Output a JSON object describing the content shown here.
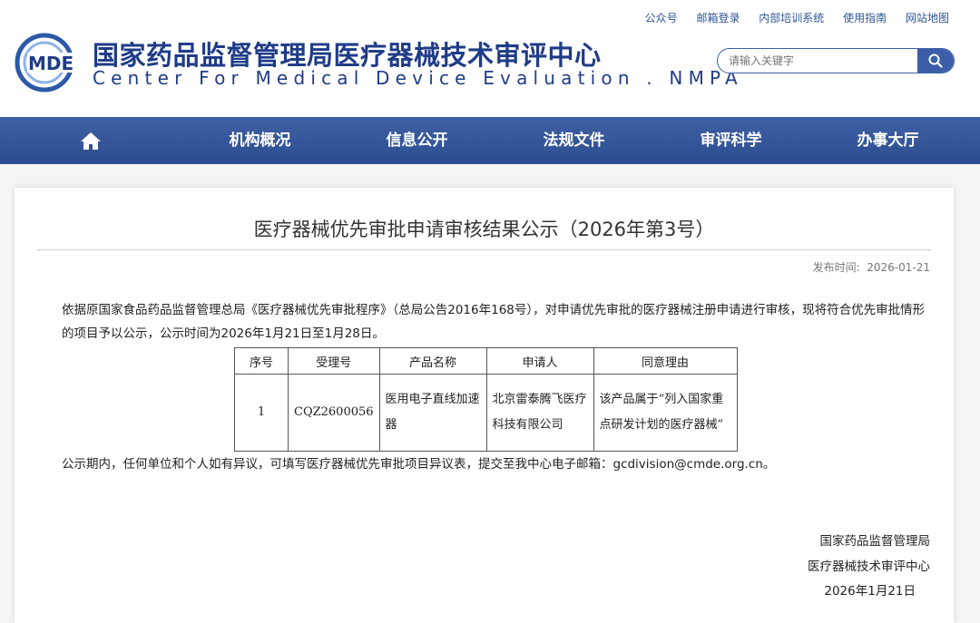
{
  "header": {
    "top_links": [
      "公众号",
      "邮箱登录",
      "内部培训系统",
      "使用指南",
      "网站地图"
    ],
    "logo_mark": "MDE",
    "logo_cn": "国家药品监督管理局医疗器械技术审评中心",
    "logo_en": "Center For Medical Device Evaluation . NMPA",
    "search_placeholder": "请输入关键字"
  },
  "nav": {
    "items": [
      "机构概况",
      "信息公开",
      "法规文件",
      "审评科学",
      "办事大厅"
    ]
  },
  "article": {
    "title": "医疗器械优先审批申请审核结果公示（2026年第3号）",
    "publish_label": "发布时间:",
    "publish_date": "2026-01-21",
    "paragraph": "依据原国家食品药品监督管理总局《医疗器械优先审批程序》（总局公告2016年168号），对申请优先审批的医疗器械注册申请进行审核，现将符合优先审批情形的项目予以公示，公示时间为2026年1月21日至1月28日。",
    "table": {
      "headers": [
        "序号",
        "受理号",
        "产品名称",
        "申请人",
        "同意理由"
      ],
      "rows": [
        [
          "1",
          "CQZ2600056",
          "医用电子直线加速器",
          "北京雷泰腾飞医疗科技有限公司",
          "该产品属于“列入国家重点研发计划的医疗器械”"
        ]
      ]
    },
    "notice": "公示期内，任何单位和个人如有异议，可填写医疗器械优先审批项目异议表，提交至我中心电子邮箱：gcdivision@cmde.org.cn。",
    "signature": {
      "org1": "国家药品监督管理局",
      "org2": "医疗器械技术审评中心",
      "date": "2026年1月21日"
    }
  },
  "colors": {
    "brand": "#1f3c88",
    "nav_bg": "#36589b",
    "link": "#2f5597"
  }
}
